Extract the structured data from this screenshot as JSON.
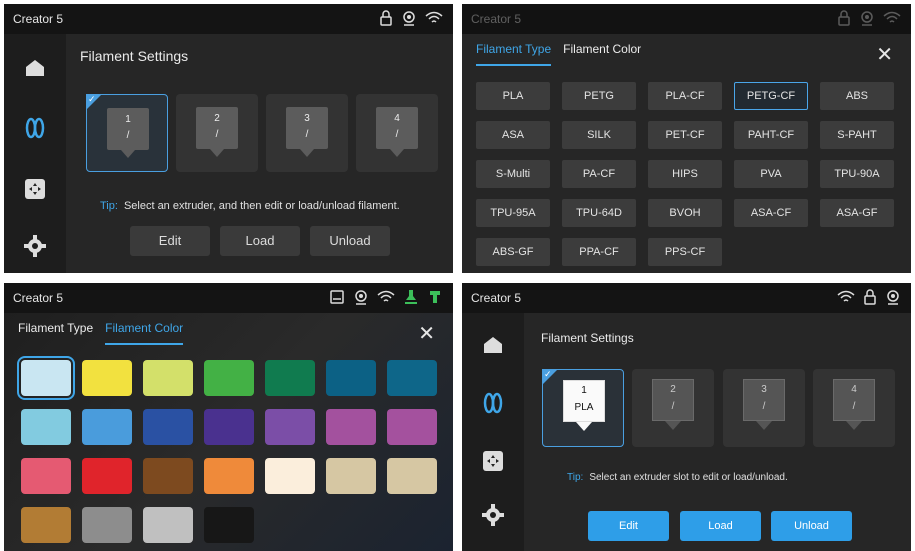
{
  "panel1": {
    "title": "Creator 5",
    "section_title": "Filament Settings",
    "slots": [
      {
        "number": "1",
        "value": "/"
      },
      {
        "number": "2",
        "value": "/"
      },
      {
        "number": "3",
        "value": "/"
      },
      {
        "number": "4",
        "value": "/"
      }
    ],
    "tip_label": "Tip:",
    "tip_text": "Select an extruder, and then edit or load/unload filament.",
    "buttons": {
      "edit": "Edit",
      "load": "Load",
      "unload": "Unload"
    }
  },
  "panel2": {
    "title": "Creator 5",
    "tab_type": "Filament Type",
    "tab_color": "Filament Color",
    "close": "✕",
    "selected": "PETG-CF",
    "types": [
      "PLA",
      "PETG",
      "PLA-CF",
      "PETG-CF",
      "ABS",
      "ASA",
      "SILK",
      "PET-CF",
      "PAHT-CF",
      "S-PAHT",
      "S-Multi",
      "PA-CF",
      "HIPS",
      "PVA",
      "TPU-90A",
      "TPU-95A",
      "TPU-64D",
      "BVOH",
      "ASA-CF",
      "ASA-GF",
      "ABS-GF",
      "PPA-CF",
      "PPS-CF"
    ]
  },
  "panel3": {
    "title": "Creator 5",
    "tab_type": "Filament Type",
    "tab_color": "Filament Color",
    "close": "✕",
    "colors": [
      "#c9e6f2",
      "#f2e13f",
      "#d3e06a",
      "#43b145",
      "#107b4f",
      "#0c6185",
      "#0e6689",
      "#82cbe0",
      "#4a9cdc",
      "#2a51a3",
      "#4a318f",
      "#7b4ea7",
      "#a3519e",
      "#a4519e",
      "#e55a72",
      "#e0242b",
      "#7d4a1f",
      "#ef8a3a",
      "#fbeedc",
      "#d6c7a3",
      "#d6c7a3",
      "#b27c34",
      "#8d8d8d",
      "#c0c0c0",
      "#171717"
    ]
  },
  "panel4": {
    "title": "Creator 5",
    "section_title": "Filament Settings",
    "slots": [
      {
        "number": "1",
        "value": "PLA"
      },
      {
        "number": "2",
        "value": "/"
      },
      {
        "number": "3",
        "value": "/"
      },
      {
        "number": "4",
        "value": "/"
      }
    ],
    "tip_label": "Tip:",
    "tip_text": "Select an extruder slot to edit or load/unload.",
    "buttons": {
      "edit": "Edit",
      "load": "Load",
      "unload": "Unload"
    }
  },
  "icons": {
    "lock": "lock-icon",
    "camera": "camera-icon",
    "wifi": "wifi-icon",
    "printer": "printer-icon",
    "home": "home-icon",
    "filament": "filament-icon",
    "move": "move-icon",
    "settings": "gear-icon"
  },
  "colors": {
    "accent": "#3fa6e8",
    "accent_button": "#2e9ee8"
  }
}
